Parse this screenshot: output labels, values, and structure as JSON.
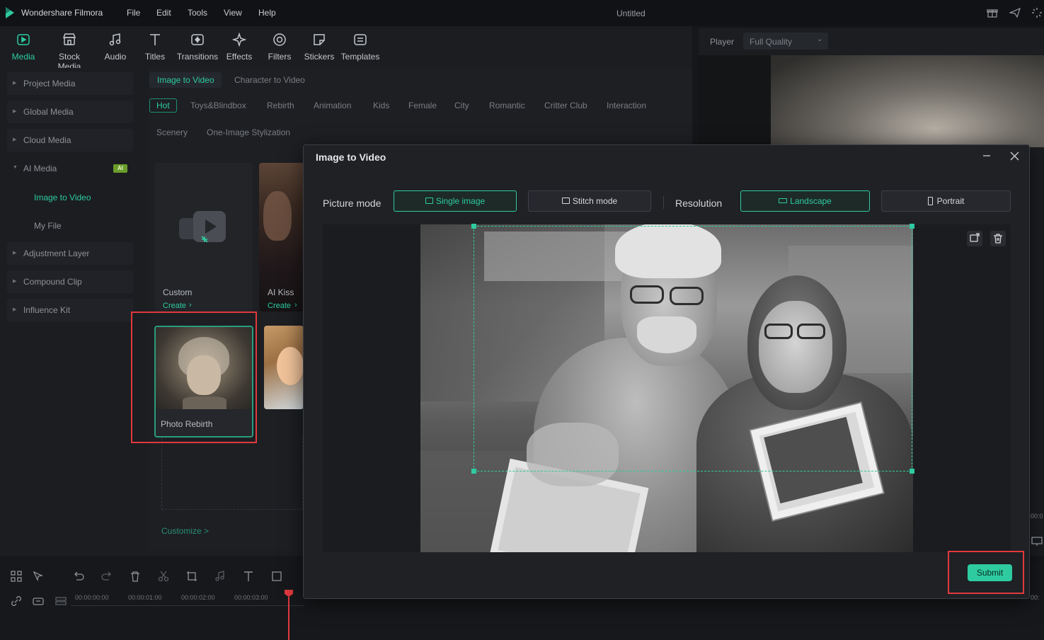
{
  "app": {
    "name": "Wondershare Filmora",
    "document_title": "Untitled"
  },
  "menu": [
    "File",
    "Edit",
    "Tools",
    "View",
    "Help"
  ],
  "toolbar": [
    "Media",
    "Stock Media",
    "Audio",
    "Titles",
    "Transitions",
    "Effects",
    "Filters",
    "Stickers",
    "Templates"
  ],
  "player": {
    "label": "Player",
    "quality": "Full Quality"
  },
  "sidebar": {
    "items": [
      "Project Media",
      "Global Media",
      "Cloud Media",
      "AI Media",
      "Adjustment Layer",
      "Compound Clip",
      "Influence Kit"
    ],
    "ai_badge": "AI",
    "sub_items": [
      "Image to Video",
      "My File"
    ]
  },
  "content": {
    "mode_tabs": [
      "Image to Video",
      "Character to Video"
    ],
    "categories": [
      "Hot",
      "Toys&Blindbox",
      "Rebirth",
      "Animation",
      "Kids",
      "Female",
      "City",
      "Romantic",
      "Critter Club",
      "Interaction",
      "Scenery",
      "One-Image Stylization"
    ],
    "cards": [
      {
        "title": "Custom",
        "action": "Create"
      },
      {
        "title": "AI Kiss",
        "action": "Create"
      },
      {
        "title": "Photo Rebirth"
      }
    ],
    "customize": "Customize >"
  },
  "dialog": {
    "title": "Image to Video",
    "picture_mode_label": "Picture mode",
    "single_image": "Single image",
    "stitch_mode": "Stitch mode",
    "resolution_label": "Resolution",
    "landscape": "Landscape",
    "portrait": "Portrait",
    "submit": "Submit"
  },
  "timeline": {
    "ruler": [
      "00:00:00:00",
      "00:00:01:00",
      "00:00:02:00",
      "00:00:03:00"
    ]
  },
  "colors": {
    "accent": "#2ecba1",
    "highlight": "#e0393e",
    "background": "#15171b"
  }
}
